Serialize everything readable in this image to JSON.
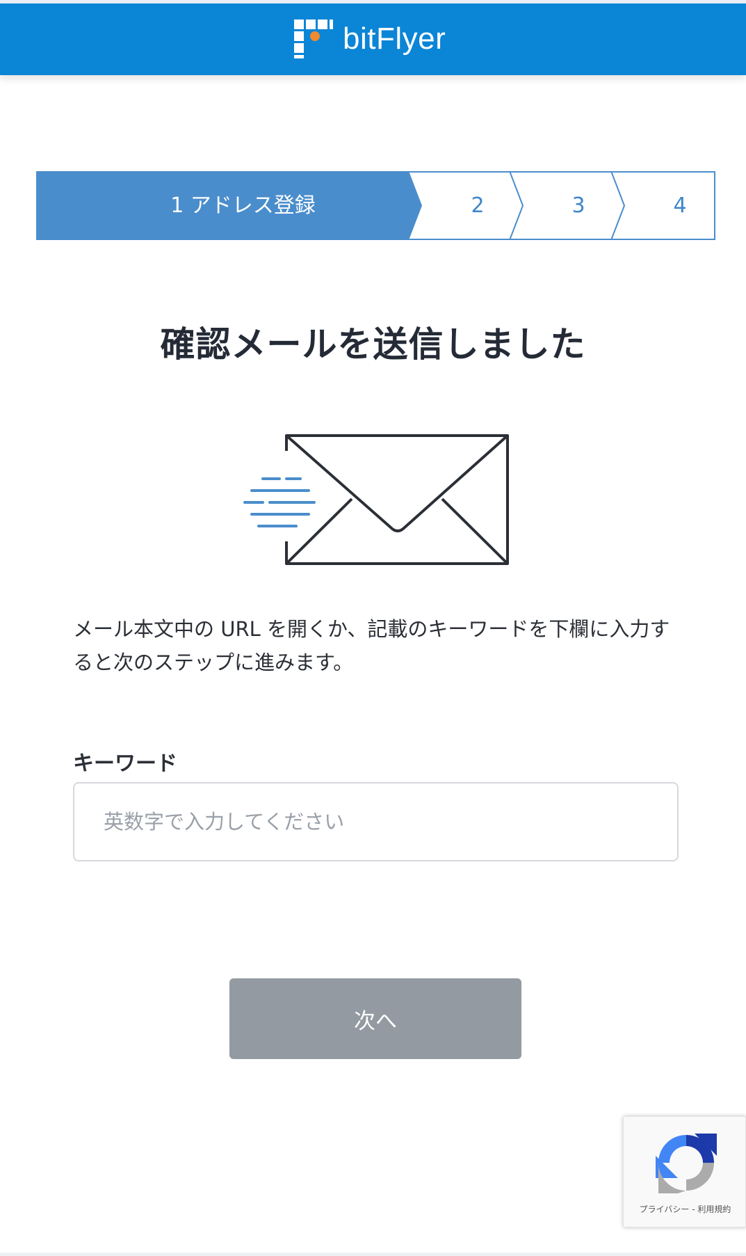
{
  "header": {
    "brand": "bitFlyer",
    "logo_icon": "bitflyer-logo-icon",
    "background_color": "#0b85d6"
  },
  "stepper": {
    "steps": [
      {
        "label": "1 アドレス登録",
        "active": true
      },
      {
        "label": "2",
        "active": false
      },
      {
        "label": "3",
        "active": false
      },
      {
        "label": "4",
        "active": false
      }
    ],
    "active_color": "#4a8dcc",
    "inactive_color": "#ffffff"
  },
  "main": {
    "title": "確認メールを送信しました",
    "illustration": "envelope-sent-icon",
    "description": "メール本文中の URL を開くか、記載のキーワードを下欄に入力すると次のステップに進みます。"
  },
  "keyword": {
    "label": "キーワード",
    "value": "",
    "placeholder": "英数字で入力してください"
  },
  "actions": {
    "next_label": "次へ",
    "next_disabled_color": "#939aa1"
  },
  "recaptcha": {
    "icon": "recaptcha-icon",
    "privacy_label": "プライバシー",
    "separator": " - ",
    "terms_label": "利用規約"
  }
}
